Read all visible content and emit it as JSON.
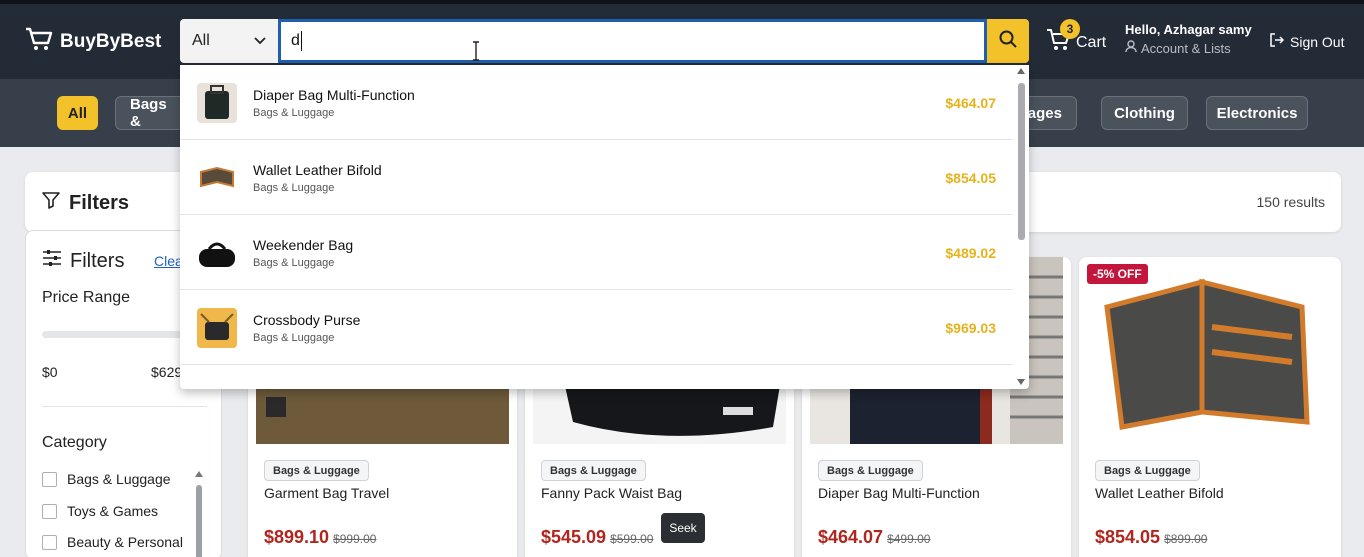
{
  "header": {
    "brand": "BuyByBest",
    "search": {
      "category": "All",
      "query": "d"
    },
    "cart": {
      "label": "Cart",
      "count": "3"
    },
    "account": {
      "greeting": "Hello, Azhagar samy",
      "lists": "Account & Lists"
    },
    "signout": "Sign Out"
  },
  "categories": {
    "all": "All",
    "bags": "Bags &",
    "beverages": "erages",
    "clothing": "Clothing",
    "electronics": "Electronics"
  },
  "filters_bar": {
    "title": "Filters",
    "results": "150 results"
  },
  "sidebar": {
    "title": "Filters",
    "clear": "Clea",
    "price_range": "Price Range",
    "min": "$0",
    "max": "$629",
    "category_label": "Category",
    "options": [
      "Bags & Luggage",
      "Toys & Games",
      "Beauty & Personal"
    ]
  },
  "suggestions": [
    {
      "name": "Diaper Bag Multi-Function",
      "category": "Bags & Luggage",
      "price": "$464.07",
      "thumb": "diaper-bag-icon"
    },
    {
      "name": "Wallet Leather Bifold",
      "category": "Bags & Luggage",
      "price": "$854.05",
      "thumb": "wallet-icon"
    },
    {
      "name": "Weekender Bag",
      "category": "Bags & Luggage",
      "price": "$489.02",
      "thumb": "duffel-bag-icon"
    },
    {
      "name": "Crossbody Purse",
      "category": "Bags & Luggage",
      "price": "$969.03",
      "thumb": "purse-icon"
    }
  ],
  "products": [
    {
      "tag": "Bags & Luggage",
      "name": "Garment Bag Travel",
      "price": "$899.10",
      "was": "$999.00"
    },
    {
      "tag": "Bags & Luggage",
      "name": "Fanny Pack Waist Bag",
      "price": "$545.09",
      "was": "$599.00"
    },
    {
      "tag": "Bags & Luggage",
      "name": "Diaper Bag Multi-Function",
      "price": "$464.07",
      "was": "$499.00"
    },
    {
      "tag": "Bags & Luggage",
      "name": "Wallet Leather Bifold",
      "price": "$854.05",
      "was": "$899.00",
      "discount": "-5% OFF"
    }
  ],
  "tooltip": "Seek",
  "colors": {
    "accent": "#f3c12a",
    "header": "#232b36",
    "price": "#b0261e",
    "link": "#1f63c6"
  }
}
